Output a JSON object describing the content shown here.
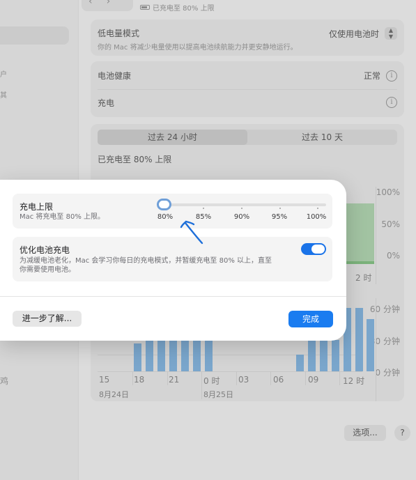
{
  "sidebar": {
    "fragments": [
      "户",
      "其",
      "鸡"
    ]
  },
  "header": {
    "battery_status": "已充电至 80% 上限"
  },
  "low_power": {
    "title": "低电量模式",
    "description": "你的 Mac 将减少电量使用以提高电池续航能力并更安静地运行。",
    "value": "仅使用电池时"
  },
  "battery_health": {
    "label": "电池健康",
    "value": "正常"
  },
  "charging": {
    "label": "充电"
  },
  "usage": {
    "tabs": [
      {
        "label": "过去 24 小时",
        "selected": true
      },
      {
        "label": "过去 10 天",
        "selected": false
      }
    ],
    "status": "已充电至 80% 上限",
    "level_axis": [
      "100%",
      "50%",
      "0%"
    ],
    "screen_axis": [
      "60 分钟",
      "30 分钟",
      "0 分钟"
    ],
    "time_labels": [
      "15",
      "18",
      "21",
      "0 时",
      "03",
      "06",
      "09",
      "12 时"
    ],
    "partial_time_label": "2 时",
    "dates": [
      "8月24日",
      "8月25日"
    ]
  },
  "footer": {
    "options_label": "选项...",
    "help_label": "?"
  },
  "sheet": {
    "charge_limit": {
      "title": "充电上限",
      "description": "Mac 将充电至 80% 上限。",
      "ticks": [
        "80%",
        "85%",
        "90%",
        "95%",
        "100%"
      ],
      "value": 0.0
    },
    "optimized": {
      "title": "优化电池充电",
      "description_line1": "为减缓电池老化，Mac 会学习你每日的充电模式，并暂缓充电至 80% 以上，直至",
      "description_line2": "你需要使用电池。",
      "enabled": true
    },
    "learn_more_label": "进一步了解...",
    "done_label": "完成"
  },
  "colors": {
    "accent": "#1a7cf0",
    "annotation": "#1e6fd9"
  }
}
